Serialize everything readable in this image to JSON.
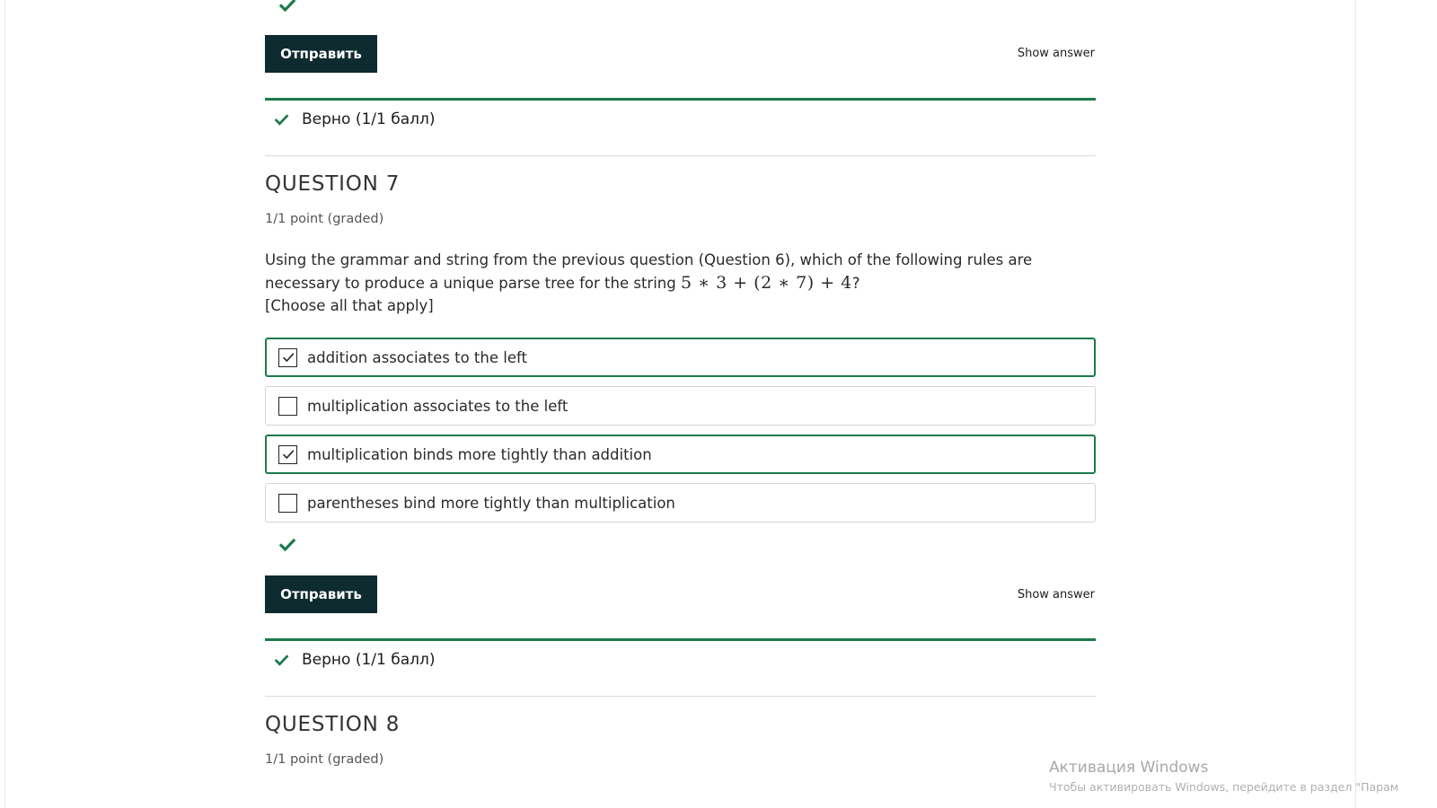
{
  "previous_question": {
    "submit_label": "Отправить",
    "show_answer_label": "Show answer",
    "feedback_text": "Верно (1/1 балл)"
  },
  "question7": {
    "title": "QUESTION 7",
    "points": "1/1 point (graded)",
    "text_line1": "Using the grammar and string from the previous question (Question 6), which of the following rules are",
    "text_line2_prefix": "necessary to produce a unique parse tree for the string ",
    "math_expression": "5 ∗ 3 + (2 ∗ 7) + 4",
    "text_line2_suffix": "?",
    "text_line3": "[Choose all that apply]",
    "options": [
      {
        "label": "addition associates to the left",
        "checked": true
      },
      {
        "label": "multiplication associates to the left",
        "checked": false
      },
      {
        "label": "multiplication binds more tightly than addition",
        "checked": true
      },
      {
        "label": "parentheses bind more tightly than multiplication",
        "checked": false
      }
    ],
    "submit_label": "Отправить",
    "show_answer_label": "Show answer",
    "feedback_text": "Верно (1/1 балл)"
  },
  "question8": {
    "title": "QUESTION 8",
    "points": "1/1 point (graded)"
  },
  "watermark": {
    "title": "Активация Windows",
    "subtitle": "Чтобы активировать Windows, перейдите в раздел \"Парам"
  },
  "colors": {
    "accent_green": "#1b7a4a",
    "button_dark": "#0e2b30"
  },
  "icons": {
    "check": "check-icon",
    "checkbox_checked": "checkbox-checked-icon"
  }
}
